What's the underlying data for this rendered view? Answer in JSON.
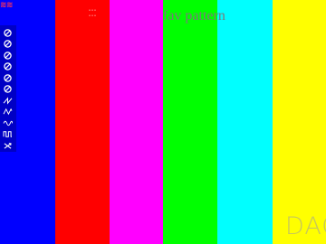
{
  "pattern": {
    "title": "fav pattern",
    "title_color": "#7a7a7a",
    "bars": [
      {
        "name": "blue",
        "color": "#0000ff"
      },
      {
        "name": "red",
        "color": "#ff0000"
      },
      {
        "name": "magenta",
        "color": "#ff00ff"
      },
      {
        "name": "green",
        "color": "#00ff00"
      },
      {
        "name": "cyan",
        "color": "#00ffff"
      },
      {
        "name": "yellow",
        "color": "#ffff00"
      }
    ]
  },
  "corner_logo": {
    "text": "≋≋",
    "color": "#ff3355"
  },
  "mini_label": {
    "line1": "•••",
    "line2": "•••",
    "color": "#ff8a8a"
  },
  "toolbar": {
    "accent": "#ffffff",
    "buttons": [
      {
        "icon": "no-entry-icon"
      },
      {
        "icon": "no-entry-icon"
      },
      {
        "icon": "no-entry-icon"
      },
      {
        "icon": "no-entry-icon"
      },
      {
        "icon": "no-entry-icon"
      },
      {
        "icon": "no-entry-icon"
      },
      {
        "icon": "sawtooth-wave-icon"
      },
      {
        "icon": "triangle-wave-icon"
      },
      {
        "icon": "sine-wave-icon"
      },
      {
        "icon": "square-wave-icon"
      },
      {
        "icon": "shuffle-icon"
      }
    ]
  },
  "watermark": {
    "text": "DAC",
    "color": "#c8c85a"
  }
}
